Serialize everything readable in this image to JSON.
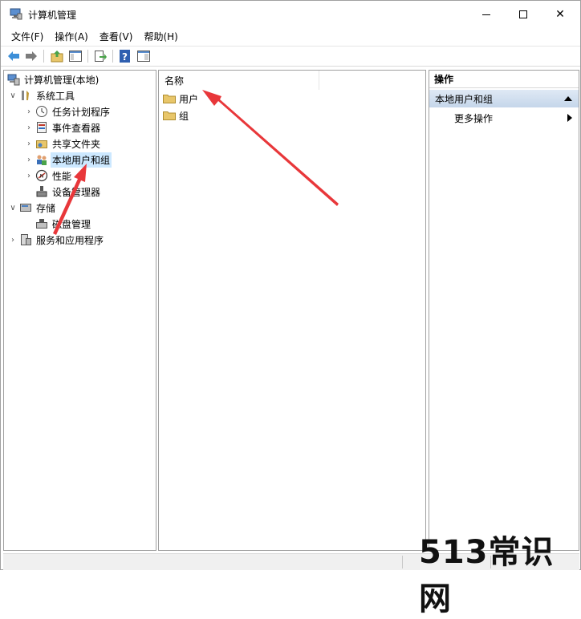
{
  "window": {
    "title": "计算机管理"
  },
  "menu": [
    "文件(F)",
    "操作(A)",
    "查看(V)",
    "帮助(H)"
  ],
  "toolbar": [
    "back-arrow-icon",
    "forward-arrow-icon",
    "up-folder-icon",
    "show-hide-tree-icon",
    "export-list-icon",
    "help-icon",
    "console-view-icon"
  ],
  "tree": {
    "root": "计算机管理(本地)",
    "items": [
      {
        "label": "系统工具",
        "level": 1,
        "expanded": true,
        "icon": "tools-icon"
      },
      {
        "label": "任务计划程序",
        "level": 2,
        "expandable": true,
        "icon": "clock-icon"
      },
      {
        "label": "事件查看器",
        "level": 2,
        "expandable": true,
        "icon": "event-viewer-icon"
      },
      {
        "label": "共享文件夹",
        "level": 2,
        "expandable": true,
        "icon": "shared-folder-icon"
      },
      {
        "label": "本地用户和组",
        "level": 2,
        "expandable": true,
        "selected": true,
        "icon": "users-icon"
      },
      {
        "label": "性能",
        "level": 2,
        "expandable": true,
        "icon": "performance-icon"
      },
      {
        "label": "设备管理器",
        "level": 2,
        "expandable": false,
        "icon": "device-manager-icon"
      },
      {
        "label": "存储",
        "level": 1,
        "expanded": true,
        "icon": "storage-icon"
      },
      {
        "label": "磁盘管理",
        "level": 2,
        "expandable": false,
        "icon": "disk-icon"
      },
      {
        "label": "服务和应用程序",
        "level": 1,
        "expandable": true,
        "icon": "services-icon"
      }
    ]
  },
  "list": {
    "column_name": "名称",
    "rows": [
      "用户",
      "组"
    ]
  },
  "actions": {
    "header": "操作",
    "section": "本地用户和组",
    "more": "更多操作"
  },
  "watermark": "513常识网",
  "colors": {
    "selection": "#cce8ff",
    "annotation_arrow": "#e8373a",
    "folder": "#e8c66a"
  }
}
